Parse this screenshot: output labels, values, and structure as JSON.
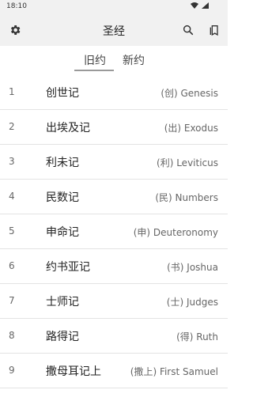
{
  "status": {
    "time": "18:10"
  },
  "app": {
    "title": "圣经"
  },
  "tabs": [
    {
      "label": "旧约",
      "active": true
    },
    {
      "label": "新约",
      "active": false
    }
  ],
  "books": [
    {
      "num": "1",
      "name": "创世记",
      "eng": "(创) Genesis"
    },
    {
      "num": "2",
      "name": "出埃及记",
      "eng": "(出) Exodus"
    },
    {
      "num": "3",
      "name": "利未记",
      "eng": "(利) Leviticus"
    },
    {
      "num": "4",
      "name": "民数记",
      "eng": "(民) Numbers"
    },
    {
      "num": "5",
      "name": "申命记",
      "eng": "(申) Deuteronomy"
    },
    {
      "num": "6",
      "name": "约书亚记",
      "eng": "(书) Joshua"
    },
    {
      "num": "7",
      "name": "士师记",
      "eng": "(士) Judges"
    },
    {
      "num": "8",
      "name": "路得记",
      "eng": "(得) Ruth"
    },
    {
      "num": "9",
      "name": "撒母耳记上",
      "eng": "(撒上) First Samuel"
    }
  ]
}
